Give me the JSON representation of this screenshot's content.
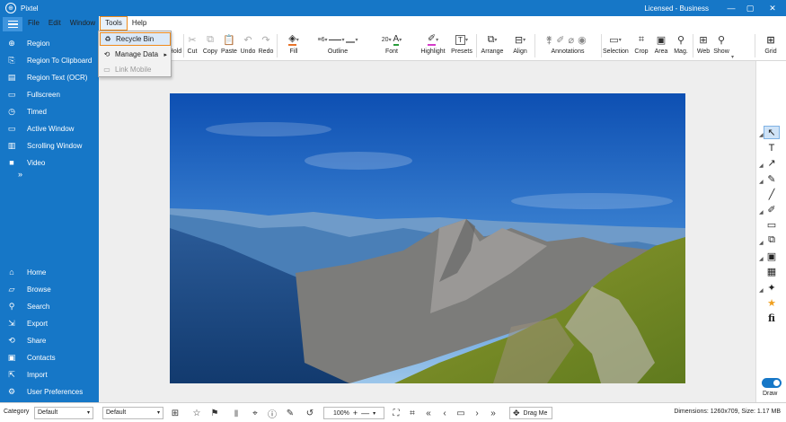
{
  "window": {
    "title": "Pixtel",
    "license": "Licensed - Business",
    "controls": [
      "—",
      "▢",
      "✕"
    ]
  },
  "menubar": [
    {
      "label": "File"
    },
    {
      "label": "Edit"
    },
    {
      "label": "Window"
    },
    {
      "label": "Tools",
      "active": true
    },
    {
      "label": "Help"
    }
  ],
  "tools_menu": [
    {
      "label": "Recycle Bin",
      "icon": "recycle-icon",
      "selected": true
    },
    {
      "label": "Manage Data",
      "icon": "data-icon",
      "submenu": true
    },
    {
      "label": "Link Mobile",
      "icon": "mobile-icon",
      "disabled": true
    }
  ],
  "sidebar": {
    "capture": [
      {
        "label": "Region",
        "icon": "region-icon"
      },
      {
        "label": "Region To Clipboard",
        "icon": "clipboard-icon"
      },
      {
        "label": "Region Text (OCR)",
        "icon": "ocr-icon"
      },
      {
        "label": "Fullscreen",
        "icon": "fullscreen-icon"
      },
      {
        "label": "Timed",
        "icon": "timer-icon"
      },
      {
        "label": "Active Window",
        "icon": "window-icon"
      },
      {
        "label": "Scrolling Window",
        "icon": "scroll-icon"
      },
      {
        "label": "Video",
        "icon": "video-icon"
      }
    ],
    "more": "»",
    "nav": [
      {
        "label": "Home",
        "icon": "home-icon"
      },
      {
        "label": "Browse",
        "icon": "folder-icon"
      },
      {
        "label": "Search",
        "icon": "search-icon"
      },
      {
        "label": "Export",
        "icon": "export-icon"
      },
      {
        "label": "Share",
        "icon": "share-icon"
      },
      {
        "label": "Contacts",
        "icon": "contacts-icon"
      },
      {
        "label": "Import",
        "icon": "import-icon"
      },
      {
        "label": "User Preferences",
        "icon": "gear-icon"
      }
    ]
  },
  "toolbar": {
    "hold": "Hold",
    "cut": "Cut",
    "copy": "Copy",
    "paste": "Paste",
    "undo": "Undo",
    "redo": "Redo",
    "fill": "Fill",
    "outline": "Outline",
    "outline_width": "6",
    "font": "Font",
    "font_size": "20",
    "highlight": "Highlight",
    "presets": "Presets",
    "arrange": "Arrange",
    "align": "Align",
    "annotations": "Annotations",
    "selection": "Selection",
    "crop": "Crop",
    "area": "Area",
    "mag": "Mag.",
    "web": "Web",
    "show": "Show",
    "grid": "Grid",
    "fill_color": "#e8742a",
    "highlight_color": "#d43cc8",
    "font_color": "#2a9d3c"
  },
  "right_tools": [
    {
      "name": "select-icon",
      "glyph": "↖",
      "selected": true
    },
    {
      "name": "text-icon",
      "glyph": "T"
    },
    {
      "name": "arrow-icon",
      "glyph": "↗"
    },
    {
      "name": "pen-icon",
      "glyph": "✎"
    },
    {
      "name": "line-icon",
      "glyph": "╱"
    },
    {
      "name": "marker-icon",
      "glyph": "✐"
    },
    {
      "name": "note-icon",
      "glyph": "▭"
    },
    {
      "name": "copy-icon",
      "glyph": "⧉"
    },
    {
      "name": "image-icon",
      "glyph": "▣"
    },
    {
      "name": "blur-icon",
      "glyph": "▦"
    },
    {
      "name": "magic-icon",
      "glyph": "✦"
    },
    {
      "name": "star-icon",
      "glyph": "★"
    },
    {
      "name": "fi-icon",
      "glyph": "fi"
    }
  ],
  "draw": {
    "label": "Draw",
    "on": true
  },
  "bottombar": {
    "category_label": "Category",
    "category_value": "Default",
    "second_value": "Default",
    "zoom": "100%",
    "drag": "Drag Me",
    "dimensions": "Dimensions: 1260x709, Size: 1.17 MB"
  }
}
